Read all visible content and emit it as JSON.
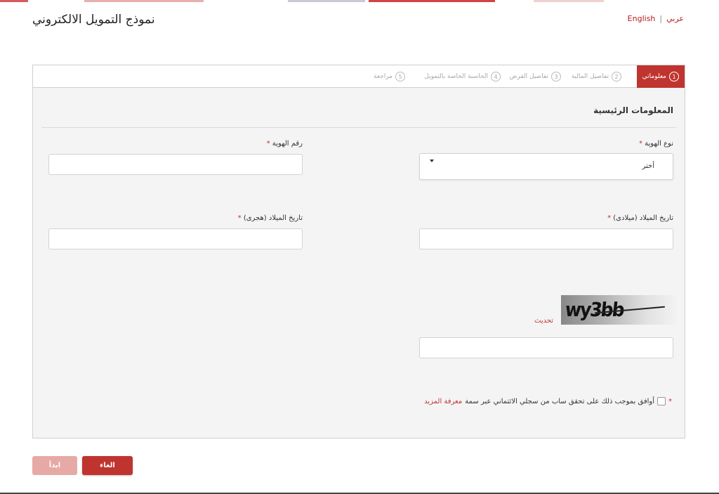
{
  "page": {
    "title": "نموذج التمويل الالكتروني"
  },
  "language": {
    "english": "English",
    "separator": "|",
    "arabic": "عربي"
  },
  "steps": [
    {
      "num": "1",
      "label": "معلوماتي"
    },
    {
      "num": "2",
      "label": "تفاصيل المالية"
    },
    {
      "num": "3",
      "label": "تفاصيل القرض"
    },
    {
      "num": "4",
      "label": "الحاسبة الخاصة بالتمويل"
    },
    {
      "num": "5",
      "label": "مراجعة"
    }
  ],
  "section": {
    "title": "المعلومات الرئيسية"
  },
  "form": {
    "id_type": {
      "label": "نوع الهوية",
      "required": "*",
      "value": "أختر"
    },
    "id_number": {
      "label": "رقم الهوية",
      "required": "*",
      "value": ""
    },
    "dob_gregorian": {
      "label": "تاريخ الميلاد (ميلادى)",
      "required": "*",
      "value": ""
    },
    "dob_hijri": {
      "label": "تاريخ الميلاد (هجرى)",
      "required": "*",
      "value": ""
    },
    "captcha": {
      "image_text": "wy3bb",
      "refresh": "تحديث",
      "value": ""
    }
  },
  "agreement": {
    "required": "*",
    "text": "أوافق بموجب ذلك على تحقق ساب من سجلي الائتماني عبر سمة",
    "more": "معرفة المزيد"
  },
  "buttons": {
    "cancel": "الغاء",
    "start": "ابدأ"
  },
  "colors": {
    "accent": "#c0342f",
    "disabled": "#e7a9a6",
    "panel_bg": "#f4f4f4"
  }
}
